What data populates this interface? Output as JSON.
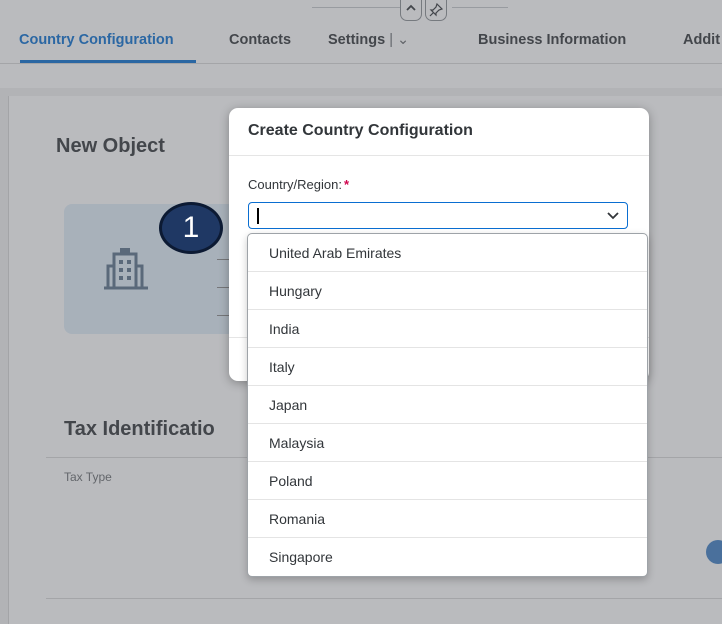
{
  "tabs": [
    {
      "label": "Country Configuration",
      "active": true
    },
    {
      "label": "Contacts"
    },
    {
      "label": "Settings"
    },
    {
      "label": "Business Information"
    },
    {
      "label": "Addit"
    }
  ],
  "settings_caret": "| ⌄",
  "header_buttons": [
    {
      "icon": "chevron-up-icon"
    },
    {
      "icon": "pin-icon"
    }
  ],
  "background": {
    "title": "New Object",
    "tax_heading": "Tax Identificatio",
    "tax_type_header": "Tax Type",
    "object_icon": "building-icon"
  },
  "dialog": {
    "title": "Create Country Configuration",
    "field_label": "Country/Region:",
    "required_mark": "*",
    "input_value": ""
  },
  "dropdown_options": [
    "United Arab Emirates",
    "Hungary",
    "India",
    "Italy",
    "Japan",
    "Malaysia",
    "Poland",
    "Romania",
    "Singapore"
  ],
  "callout": {
    "number": "1"
  },
  "colors": {
    "accent": "#0a6ed1",
    "required": "#d0054e",
    "callout_fill": "#1f3864"
  }
}
